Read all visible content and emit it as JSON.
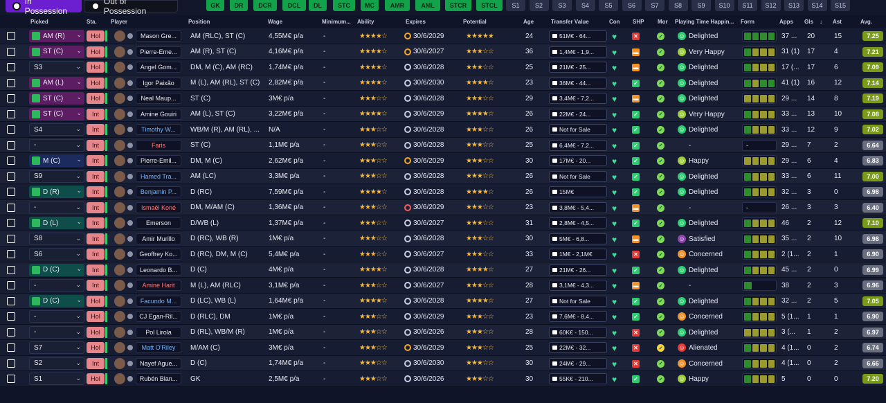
{
  "tabs": {
    "in_possession": "In Possession",
    "out_of_possession": "Out of Possession"
  },
  "position_buttons": [
    "GK",
    "DR",
    "DCR",
    "DCL",
    "DL",
    "STC",
    "MC",
    "AMR",
    "AML",
    "STCR",
    "STCL"
  ],
  "set_buttons": [
    "S1",
    "S2",
    "S3",
    "S4",
    "S5",
    "S6",
    "S7",
    "S8",
    "S9",
    "S10",
    "S11",
    "S12",
    "S13",
    "S14",
    "S15"
  ],
  "headers": {
    "picked": "Picked",
    "sta": "Sta.",
    "player": "Player",
    "position": "Position",
    "wage": "Wage",
    "minimum": "Minimum...",
    "ability": "Ability",
    "expires": "Expires",
    "potential": "Potential",
    "age": "Age",
    "transfer_value": "Transfer Value",
    "con": "Con",
    "shp": "SHP",
    "mor": "Mor",
    "playing_time": "Playing Time Happin...",
    "form": "Form",
    "apps": "Apps",
    "gls": "Gls",
    "ast": "Ast",
    "avg": "Avg.",
    "sort_arrow": "↓"
  },
  "colors": {
    "selected_tab": "#6b1fd0",
    "pos_btn": "#12a24a",
    "status_hol": "#e6868a",
    "heart": "#3ddc97"
  },
  "rows": [
    {
      "picked": "AM (R)",
      "pick_type": "assigned",
      "sta": "Hol",
      "name": "Mason Gre...",
      "name_style": "",
      "position": "AM (RLC), ST (C)",
      "wage": "4,55M€ p/a",
      "minimum": "-",
      "ability": 4,
      "exp_clock": "o",
      "expires": "30/6/2029",
      "potential": 4.5,
      "age": "24",
      "tv": "51M€ - 64...",
      "shp": "x",
      "mor": "g",
      "ptd": "g",
      "pt": "Delighted",
      "form": [
        "#2e8b2e",
        "#2e8b2e",
        "#2e8b2e",
        "#2e8b2e"
      ],
      "apps": "37 ...",
      "gls": "20",
      "ast": "15",
      "avg": "7.25",
      "avg_color": "#7a9a1a"
    },
    {
      "picked": "ST (C)",
      "pick_type": "assigned",
      "sta": "Hol",
      "name": "Pierre-Eme...",
      "name_style": "",
      "position": "AM (R), ST (C)",
      "wage": "4,16M€ p/a",
      "minimum": "-",
      "ability": 4,
      "exp_clock": "o",
      "expires": "30/6/2027",
      "potential": 3,
      "age": "36",
      "tv": "1,4M€ - 1,9...",
      "shp": "o",
      "mor": "g",
      "ptd": "y",
      "pt": "Very Happy",
      "form": [
        "#2e8b2e",
        "#9a9a2e",
        "#9a9a2e",
        "#9a9a2e"
      ],
      "apps": "31 (1)",
      "gls": "17",
      "ast": "4",
      "avg": "7.21",
      "avg_color": "#7a9a1a"
    },
    {
      "picked": "S3",
      "pick_type": "sub",
      "sta": "Hol",
      "name": "Angel Gom...",
      "name_style": "",
      "position": "DM, M (C), AM (RC)",
      "wage": "1,74M€ p/a",
      "minimum": "-",
      "ability": 3.5,
      "exp_clock": "w",
      "expires": "30/6/2028",
      "potential": 3,
      "age": "25",
      "tv": "21M€ - 25...",
      "shp": "o",
      "mor": "g",
      "ptd": "g",
      "pt": "Delighted",
      "form": [
        "#2e8b2e",
        "#9a9a2e",
        "#9a9a2e",
        "#9a9a2e"
      ],
      "apps": "17 (...",
      "gls": "17",
      "ast": "6",
      "avg": "7.09",
      "avg_color": "#7a9a1a"
    },
    {
      "picked": "AM (L)",
      "pick_type": "assigned",
      "sta": "Hol",
      "name": "Igor Paixão",
      "name_style": "",
      "position": "M (L), AM (RL), ST (C)",
      "wage": "2,82M€ p/a",
      "minimum": "-",
      "ability": 3.5,
      "exp_clock": "w",
      "expires": "30/6/2030",
      "potential": 4,
      "age": "23",
      "tv": "36M€ - 44...",
      "shp": "g",
      "mor": "g",
      "ptd": "g",
      "pt": "Delighted",
      "form": [
        "#2e8b2e",
        "#9a9a2e",
        "#2e8b2e",
        "#2e8b2e"
      ],
      "apps": "41 (1)",
      "gls": "16",
      "ast": "12",
      "avg": "7.14",
      "avg_color": "#7a9a1a"
    },
    {
      "picked": "ST (C)",
      "pick_type": "assigned",
      "sta": "Hol",
      "name": "Neal Maup...",
      "name_style": "",
      "position": "ST (C)",
      "wage": "3M€ p/a",
      "minimum": "-",
      "ability": 3,
      "exp_clock": "w",
      "expires": "30/6/2028",
      "potential": 3,
      "age": "29",
      "tv": "3,4M€ - 7,2...",
      "shp": "o",
      "mor": "g",
      "ptd": "g",
      "pt": "Delighted",
      "form": [
        "#9a9a2e",
        "#9a9a2e",
        "#9a9a2e",
        "#9a9a2e"
      ],
      "apps": "29 ...",
      "gls": "14",
      "ast": "8",
      "avg": "7.19",
      "avg_color": "#7a9a1a"
    },
    {
      "picked": "ST (C)",
      "pick_type": "assigned",
      "sta": "Int",
      "name": "Amine Gouiri",
      "name_style": "",
      "position": "AM (L), ST (C)",
      "wage": "3,22M€ p/a",
      "minimum": "-",
      "ability": 3.5,
      "exp_clock": "w",
      "expires": "30/6/2029",
      "potential": 3.5,
      "age": "26",
      "tv": "22M€ - 24...",
      "shp": "g",
      "mor": "g",
      "ptd": "y",
      "pt": "Very Happy",
      "form": [
        "#2e8b2e",
        "#9a9a2e",
        "#9a9a2e",
        "#9a9a2e"
      ],
      "apps": "33 ...",
      "gls": "13",
      "ast": "10",
      "avg": "7.08",
      "avg_color": "#7a9a1a"
    },
    {
      "picked": "S4",
      "pick_type": "sub",
      "sta": "Int",
      "name": "Timothy W...",
      "name_style": "blue",
      "position": "WB/M (R), AM (RL), ...",
      "wage": "N/A",
      "minimum": "-",
      "ability": 3,
      "exp_clock": "w",
      "expires": "30/6/2028",
      "potential": 3,
      "age": "26",
      "tv": "Not for Sale",
      "shp": "g",
      "mor": "g",
      "ptd": "g",
      "pt": "Delighted",
      "form": [
        "#2e8b2e",
        "#9a9a2e",
        "#9a9a2e",
        "#9a9a2e"
      ],
      "apps": "33 ...",
      "gls": "12",
      "ast": "9",
      "avg": "7.02",
      "avg_color": "#7a9a1a"
    },
    {
      "picked": "-",
      "pick_type": "sub",
      "sta": "Int",
      "name": "Faris",
      "name_style": "red",
      "position": "ST (C)",
      "wage": "1,1M€ p/a",
      "minimum": "-",
      "ability": 3,
      "exp_clock": "w",
      "expires": "30/6/2028",
      "potential": 3,
      "age": "25",
      "tv": "6,4M€ - 7,2...",
      "shp": "g",
      "mor": "g",
      "ptd": "",
      "pt": "-",
      "form": [],
      "form_dash": "-",
      "apps": "29 ...",
      "gls": "7",
      "ast": "2",
      "avg": "6.64",
      "avg_color": "#6a6f80"
    },
    {
      "picked": "M (C)",
      "pick_type": "gk",
      "sta": "Int",
      "name": "Pierre-Emil...",
      "name_style": "",
      "position": "DM, M (C)",
      "wage": "2,62M€ p/a",
      "minimum": "-",
      "ability": 3,
      "exp_clock": "o",
      "expires": "30/6/2029",
      "potential": 3,
      "age": "30",
      "tv": "17M€ - 20...",
      "shp": "g",
      "mor": "g",
      "ptd": "y",
      "pt": "Happy",
      "form": [
        "#9a9a2e",
        "#9a9a2e",
        "#9a9a2e",
        "#9a9a2e"
      ],
      "apps": "29 ...",
      "gls": "6",
      "ast": "4",
      "avg": "6.83",
      "avg_color": "#6a6f80"
    },
    {
      "picked": "S9",
      "pick_type": "sub",
      "sta": "Int",
      "name": "Hamed Tra...",
      "name_style": "blue",
      "position": "AM (LC)",
      "wage": "3,3M€ p/a",
      "minimum": "-",
      "ability": 3,
      "exp_clock": "w",
      "expires": "30/6/2028",
      "potential": 3,
      "age": "26",
      "tv": "Not for Sale",
      "shp": "g",
      "mor": "g",
      "ptd": "g",
      "pt": "Delighted",
      "form": [
        "#2e8b2e",
        "#9a9a2e",
        "#9a9a2e",
        "#9a9a2e"
      ],
      "apps": "33 ...",
      "gls": "6",
      "ast": "11",
      "avg": "7.00",
      "avg_color": "#7a9a1a"
    },
    {
      "picked": "D (R)",
      "pick_type": "def",
      "sta": "Int",
      "name": "Benjamin P...",
      "name_style": "blue",
      "position": "D (RC)",
      "wage": "7,59M€ p/a",
      "minimum": "-",
      "ability": 4,
      "exp_clock": "w",
      "expires": "30/6/2028",
      "potential": 4,
      "age": "26",
      "tv": "15M€",
      "shp": "g",
      "mor": "g",
      "ptd": "g",
      "pt": "Delighted",
      "form": [
        "#2e8b2e",
        "#9a9a2e",
        "#9a9a2e",
        "#9a9a2e"
      ],
      "apps": "32 ...",
      "gls": "3",
      "ast": "0",
      "avg": "6.98",
      "avg_color": "#6a6f80"
    },
    {
      "picked": "-",
      "pick_type": "sub",
      "sta": "Int",
      "name": "Ismaël Koné",
      "name_style": "red",
      "position": "DM, M/AM (C)",
      "wage": "1,36M€ p/a",
      "minimum": "-",
      "ability": 3,
      "exp_clock": "r",
      "expires": "30/6/2029",
      "potential": 3,
      "age": "23",
      "tv": "3,8M€ - 5,4...",
      "shp": "o",
      "mor": "g",
      "ptd": "",
      "pt": "-",
      "form": [],
      "form_dash": "-",
      "apps": "26 ...",
      "gls": "3",
      "ast": "3",
      "avg": "6.40",
      "avg_color": "#6a6f80"
    },
    {
      "picked": "D (L)",
      "pick_type": "def",
      "sta": "Int",
      "name": "Emerson",
      "name_style": "",
      "position": "D/WB (L)",
      "wage": "1,37M€ p/a",
      "minimum": "-",
      "ability": 3,
      "exp_clock": "w",
      "expires": "30/6/2027",
      "potential": 3,
      "age": "31",
      "tv": "2,8M€ - 4,5...",
      "shp": "g",
      "mor": "g",
      "ptd": "g",
      "pt": "Delighted",
      "form": [
        "#2e8b2e",
        "#9a9a2e",
        "#9a9a2e",
        "#9a9a2e"
      ],
      "apps": "46",
      "gls": "2",
      "ast": "12",
      "avg": "7.10",
      "avg_color": "#7a9a1a"
    },
    {
      "picked": "S8",
      "pick_type": "sub",
      "sta": "Int",
      "name": "Amir Murillo",
      "name_style": "",
      "position": "D (RC), WB (R)",
      "wage": "1M€ p/a",
      "minimum": "-",
      "ability": 2.5,
      "exp_clock": "w",
      "expires": "30/6/2028",
      "potential": 2.5,
      "age": "30",
      "tv": "5M€ - 6,8...",
      "shp": "o",
      "mor": "g",
      "ptd": "p",
      "pt": "Satisfied",
      "form": [
        "#2e8b2e",
        "#9a9a2e",
        "#9a9a2e",
        "#9a9a2e"
      ],
      "apps": "35 ...",
      "gls": "2",
      "ast": "10",
      "avg": "6.98",
      "avg_color": "#6a6f80"
    },
    {
      "picked": "S6",
      "pick_type": "sub",
      "sta": "Int",
      "name": "Geoffrey Ko...",
      "name_style": "",
      "position": "D (RC), DM, M (C)",
      "wage": "5,4M€ p/a",
      "minimum": "-",
      "ability": 3,
      "exp_clock": "w",
      "expires": "30/6/2027",
      "potential": 3,
      "age": "33",
      "tv": "1M€ - 2,1M€",
      "shp": "x",
      "mor": "g",
      "ptd": "o",
      "pt": "Concerned",
      "form": [
        "#2e8b2e",
        "#9a9a2e",
        "#9a9a2e",
        "#9a9a2e"
      ],
      "apps": "2 (1...",
      "gls": "2",
      "ast": "1",
      "avg": "6.90",
      "avg_color": "#6a6f80"
    },
    {
      "picked": "D (C)",
      "pick_type": "def",
      "sta": "Int",
      "name": "Leonardo B...",
      "name_style": "",
      "position": "D (C)",
      "wage": "4M€ p/a",
      "minimum": "-",
      "ability": 3.5,
      "exp_clock": "w",
      "expires": "30/6/2028",
      "potential": 3.5,
      "age": "27",
      "tv": "21M€ - 26...",
      "shp": "g",
      "mor": "g",
      "ptd": "g",
      "pt": "Delighted",
      "form": [
        "#2e8b2e",
        "#9a9a2e",
        "#9a9a2e",
        "#9a9a2e"
      ],
      "apps": "45 ...",
      "gls": "2",
      "ast": "0",
      "avg": "6.99",
      "avg_color": "#6a6f80"
    },
    {
      "picked": "-",
      "pick_type": "sub",
      "sta": "Int",
      "name": "Amine Harit",
      "name_style": "red",
      "position": "M (L), AM (RLC)",
      "wage": "3,1M€ p/a",
      "minimum": "-",
      "ability": 3,
      "exp_clock": "w",
      "expires": "30/6/2027",
      "potential": 3,
      "age": "28",
      "tv": "3,1M€ - 4,3...",
      "shp": "o",
      "mor": "g",
      "ptd": "",
      "pt": "-",
      "form": [
        "#2e8b2e"
      ],
      "apps": "38",
      "gls": "2",
      "ast": "3",
      "avg": "6.96",
      "avg_color": "#6a6f80"
    },
    {
      "picked": "D (C)",
      "pick_type": "def",
      "sta": "Hol",
      "name": "Facundo M...",
      "name_style": "blue",
      "position": "D (LC), WB (L)",
      "wage": "1,64M€ p/a",
      "minimum": "-",
      "ability": 3.5,
      "exp_clock": "w",
      "expires": "30/6/2028",
      "potential": 3.5,
      "age": "27",
      "tv": "Not for Sale",
      "shp": "g",
      "mor": "g",
      "ptd": "g",
      "pt": "Delighted",
      "form": [
        "#2e8b2e",
        "#9a9a2e",
        "#9a9a2e",
        "#9a9a2e"
      ],
      "apps": "32 ...",
      "gls": "2",
      "ast": "5",
      "avg": "7.05",
      "avg_color": "#7a9a1a"
    },
    {
      "picked": "-",
      "pick_type": "sub",
      "sta": "Hol",
      "name": "CJ Egan-Ril...",
      "name_style": "",
      "position": "D (RLC), DM",
      "wage": "1M€ p/a",
      "minimum": "-",
      "ability": 2.5,
      "exp_clock": "w",
      "expires": "30/6/2029",
      "potential": 2.5,
      "age": "23",
      "tv": "7,6M€ - 8,4...",
      "shp": "g",
      "mor": "g",
      "ptd": "o",
      "pt": "Concerned",
      "form": [
        "#2e8b2e",
        "#9a9a2e",
        "#9a9a2e",
        "#9a9a2e"
      ],
      "apps": "5 (1...",
      "gls": "1",
      "ast": "1",
      "avg": "6.90",
      "avg_color": "#6a6f80"
    },
    {
      "picked": "-",
      "pick_type": "sub",
      "sta": "Hol",
      "name": "Pol Lirola",
      "name_style": "",
      "position": "D (RL), WB/M (R)",
      "wage": "1M€ p/a",
      "minimum": "-",
      "ability": 2.5,
      "exp_clock": "w",
      "expires": "30/6/2026",
      "potential": 2.5,
      "age": "28",
      "tv": "60K€ - 150...",
      "shp": "x",
      "mor": "g",
      "ptd": "g",
      "pt": "Delighted",
      "form": [
        "#9a9a2e",
        "#9a9a2e",
        "#9a9a2e",
        "#9a9a2e"
      ],
      "apps": "3 (...",
      "gls": "1",
      "ast": "2",
      "avg": "6.97",
      "avg_color": "#6a6f80"
    },
    {
      "picked": "S7",
      "pick_type": "sub",
      "sta": "Hol",
      "name": "Matt O'Riley",
      "name_style": "blue",
      "position": "M/AM (C)",
      "wage": "3M€ p/a",
      "minimum": "-",
      "ability": 3,
      "exp_clock": "o",
      "expires": "30/6/2029",
      "potential": 3,
      "age": "25",
      "tv": "22M€ - 32...",
      "shp": "x",
      "mor": "y",
      "ptd": "r",
      "pt": "Alienated",
      "form": [
        "#2e8b2e",
        "#9a9a2e",
        "#9a9a2e",
        "#9a9a2e"
      ],
      "apps": "4 (1...",
      "gls": "0",
      "ast": "2",
      "avg": "6.74",
      "avg_color": "#6a6f80"
    },
    {
      "picked": "S2",
      "pick_type": "sub",
      "sta": "Int",
      "name": "Nayef Ague...",
      "name_style": "",
      "position": "D (C)",
      "wage": "1,74M€ p/a",
      "minimum": "-",
      "ability": 2.5,
      "exp_clock": "w",
      "expires": "30/6/2030",
      "potential": 2.5,
      "age": "30",
      "tv": "24M€ - 29...",
      "shp": "x",
      "mor": "g",
      "ptd": "o",
      "pt": "Concerned",
      "form": [
        "#2e8b2e",
        "#9a9a2e",
        "#9a9a2e",
        "#9a9a2e"
      ],
      "apps": "4 (1...",
      "gls": "0",
      "ast": "2",
      "avg": "6.66",
      "avg_color": "#6a6f80"
    },
    {
      "picked": "S1",
      "pick_type": "sub",
      "sta": "Hol",
      "name": "Rubén Blan...",
      "name_style": "",
      "position": "GK",
      "wage": "2,5M€ p/a",
      "minimum": "-",
      "ability": 2.5,
      "exp_clock": "w",
      "expires": "30/6/2026",
      "potential": 2.5,
      "age": "30",
      "tv": "55K€ - 210...",
      "shp": "g",
      "mor": "g",
      "ptd": "y",
      "pt": "Happy",
      "form": [
        "#2e8b2e",
        "#9a9a2e",
        "#9a9a2e",
        "#9a9a2e"
      ],
      "apps": "5",
      "gls": "0",
      "ast": "0",
      "avg": "7.20",
      "avg_color": "#7a9a1a"
    }
  ]
}
